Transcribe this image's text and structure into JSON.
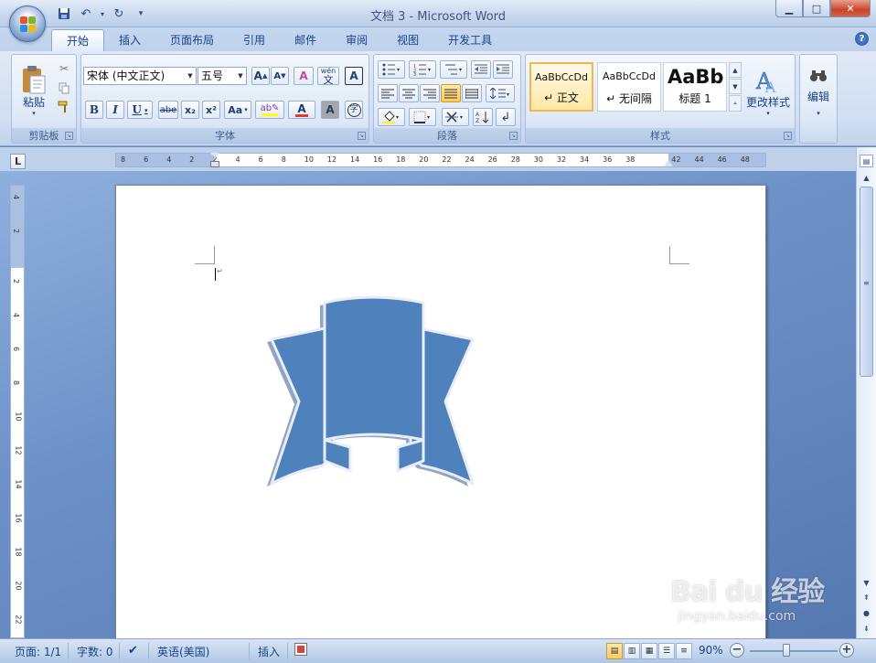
{
  "window": {
    "title": "文档 3 - Microsoft Word",
    "controls": {
      "minimize": "▁",
      "maximize": "□",
      "close": "✕"
    }
  },
  "qat": {
    "save": "save-icon",
    "undo": "undo-icon",
    "redo": "redo-icon",
    "more": "▾"
  },
  "tabs": [
    {
      "label": "开始",
      "active": true
    },
    {
      "label": "插入"
    },
    {
      "label": "页面布局"
    },
    {
      "label": "引用"
    },
    {
      "label": "邮件"
    },
    {
      "label": "审阅"
    },
    {
      "label": "视图"
    },
    {
      "label": "开发工具"
    }
  ],
  "help": "?",
  "ribbon": {
    "clipboard": {
      "label": "剪贴板",
      "paste": "粘贴"
    },
    "font": {
      "label": "字体",
      "font_name": "宋体 (中文正文)",
      "font_size": "五号",
      "bold": "B",
      "italic": "I",
      "underline": "U",
      "strike": "abe",
      "subscript": "x₂",
      "superscript": "x²",
      "change_case": "Aa",
      "grow": "A",
      "shrink": "A",
      "clear": "A",
      "pinyin": "wén",
      "border": "A",
      "shade": "A",
      "enclose": "字"
    },
    "paragraph": {
      "label": "段落"
    },
    "styles": {
      "label": "样式",
      "items": [
        {
          "sample": "AaBbCcDd",
          "name": "↵ 正文"
        },
        {
          "sample": "AaBbCcDd",
          "name": "↵ 无间隔"
        },
        {
          "sample": "AaBb",
          "name": "标题 1"
        }
      ],
      "change_styles": "更改样式"
    },
    "editing": {
      "label": "编辑"
    }
  },
  "ruler": {
    "h_ticks": [
      "8",
      "6",
      "4",
      "2",
      "2",
      "4",
      "6",
      "8",
      "10",
      "12",
      "14",
      "16",
      "18",
      "20",
      "22",
      "24",
      "26",
      "28",
      "30",
      "32",
      "34",
      "36",
      "38",
      "42",
      "44",
      "46",
      "48"
    ],
    "v_ticks": [
      "4",
      "2",
      "2",
      "4",
      "6",
      "8",
      "10",
      "12",
      "14",
      "16",
      "18",
      "20",
      "22"
    ],
    "corner": "L"
  },
  "status": {
    "page": "页面: 1/1",
    "words": "字数: 0",
    "language": "英语(美国)",
    "mode": "插入",
    "zoom": "90%"
  },
  "colors": {
    "shape_fill": "#4f81bd",
    "shape_shadow": "#8ea5c6",
    "shape_outline": "#e9eef6",
    "selected_style": "#f0b84d"
  },
  "watermark": {
    "brand": "Bai du 经验",
    "url": "jingyan.baidu.com"
  }
}
